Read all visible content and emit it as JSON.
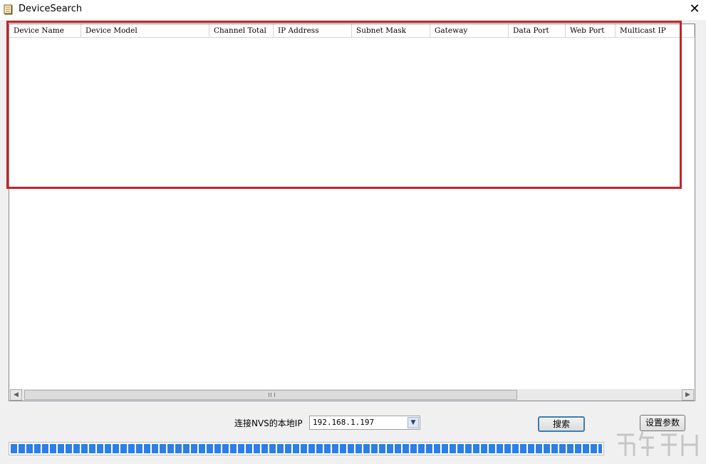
{
  "window": {
    "title": "DeviceSearch",
    "close_glyph": "✕",
    "icon": "notebook-icon"
  },
  "table": {
    "columns": [
      "Device Name",
      "Device Model",
      "Channel Total",
      "IP Address",
      "Subnet Mask",
      "Gateway",
      "Data Port",
      "Web Port",
      "Multicast IP"
    ],
    "rows": []
  },
  "scrollbar": {
    "left_arrow": "◀",
    "right_arrow": "▶"
  },
  "controls": {
    "ip_label": "连接NVS的本地IP",
    "ip_value": "192.168.1.197",
    "dropdown_arrow": "▼",
    "search_button": "搜索",
    "settings_button": "设置参数"
  },
  "progress": {
    "fraction": 1.0
  },
  "colors": {
    "highlight": "#c0252c",
    "progress": "#2b7fe6"
  }
}
